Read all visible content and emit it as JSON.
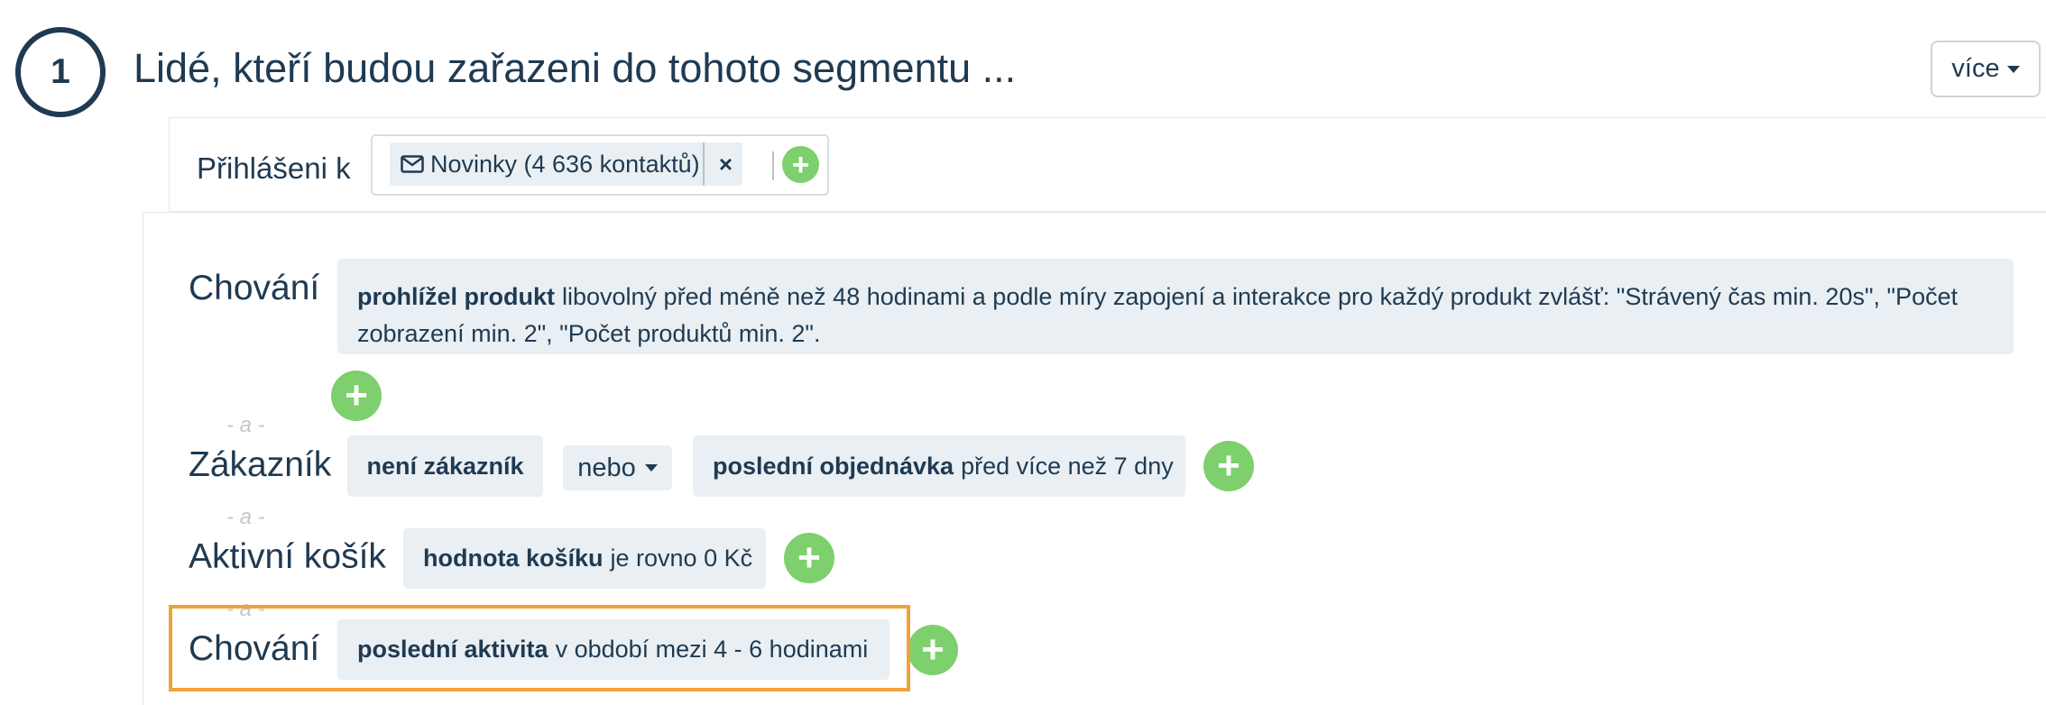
{
  "step": {
    "number": "1",
    "title": "Lidé, kteří budou zařazeni do tohoto segmentu ..."
  },
  "more_button": {
    "label": "více"
  },
  "subscribed": {
    "label": "Přihlášeni k",
    "tag": {
      "icon": "envelope-icon",
      "text": "Novinky (4 636 kontaktů)",
      "remove": "×"
    },
    "add": "+"
  },
  "conditions": {
    "and_label": "- a -",
    "groups": [
      {
        "label": "Chování",
        "items": [
          {
            "bold": "prohlížel produkt",
            "text": "libovolný před méně než 48 hodinami a podle míry zapojení a interakce pro každý produkt zvlášť: \"Strávený čas min. 20s\", \"Počet zobrazení min. 2\", \"Počet produktů min. 2\"."
          }
        ],
        "add": "+"
      },
      {
        "label": "Zákazník",
        "items": [
          {
            "bold": "není zákazník",
            "text": ""
          },
          {
            "bold": "poslední objednávka",
            "text": "před více než 7 dny"
          }
        ],
        "operator": "nebo",
        "add": "+"
      },
      {
        "label": "Aktivní košík",
        "items": [
          {
            "bold": "hodnota košíku",
            "text": "je rovno 0 Kč"
          }
        ],
        "add": "+"
      },
      {
        "label": "Chování",
        "items": [
          {
            "bold": "poslední aktivita",
            "text": "v období mezi 4 - 6 hodinami"
          }
        ],
        "add": "+",
        "highlighted": true
      }
    ]
  },
  "colors": {
    "text": "#1f3a52",
    "chip_background": "#e9eff3",
    "add_button": "#7dd06d",
    "highlight": "#f0a23a"
  }
}
